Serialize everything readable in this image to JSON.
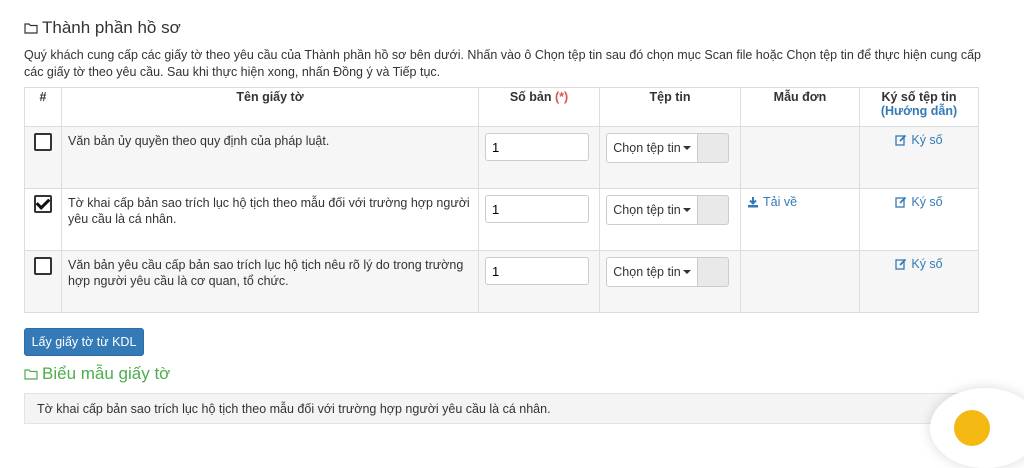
{
  "section": {
    "title": "Thành phần hồ sơ",
    "icon": "folder-open-icon"
  },
  "intro": "Quý khách cung cấp các giấy tờ theo yêu cầu của Thành phần hồ sơ bên dưới. Nhấn vào ô Chọn tệp tin sau đó chọn mục Scan file hoặc Chọn tệp tin để thực hiện cung cấp các giấy tờ theo yêu cầu. Sau khi thực hiện xong, nhấn Đồng ý và Tiếp tục.",
  "table": {
    "headers": {
      "index": "#",
      "name": "Tên giấy tờ",
      "quantity": "Số bản",
      "required_mark": "(*)",
      "file": "Tệp tin",
      "form": "Mẫu đơn",
      "sign": "Ký số tệp tin",
      "sign_guide": "(Hướng dẫn)"
    },
    "rows": [
      {
        "checked": false,
        "name": "Văn bản ủy quyền theo quy định của pháp luật.",
        "quantity": "1",
        "file_button": "Chọn tệp tin",
        "form_link": "",
        "sign_link": "Ký số"
      },
      {
        "checked": true,
        "name": "Tờ khai cấp bản sao trích lục hộ tịch theo mẫu đối với trường hợp người yêu cầu là cá nhân.",
        "quantity": "1",
        "file_button": "Chọn tệp tin",
        "form_link": "Tải về",
        "sign_link": "Ký số"
      },
      {
        "checked": false,
        "name": "Văn bản yêu cầu cấp bản sao trích lục hộ tịch nêu rõ lý do trong trường hợp người yêu cầu là cơ quan, tổ chức.",
        "quantity": "1",
        "file_button": "Chọn tệp tin",
        "form_link": "",
        "sign_link": "Ký số"
      }
    ]
  },
  "kdl_button": "Lấy giấy tờ từ KDL",
  "forms_section": {
    "title": "Biểu mẫu giấy tờ",
    "items": [
      "Tờ khai cấp bản sao trích lục hộ tịch theo mẫu đối với trường hợp người yêu cầu là cá nhân."
    ]
  },
  "colors": {
    "primary": "#337ab7",
    "success": "#4cae4c",
    "required": "#d9534f",
    "fab": "#f5b914"
  }
}
